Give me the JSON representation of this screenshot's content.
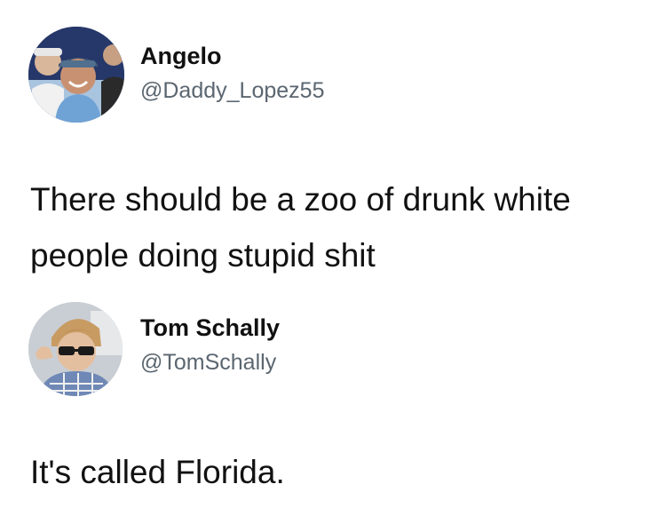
{
  "tweets": [
    {
      "author_name": "Angelo",
      "author_handle": "@Daddy_Lopez55",
      "text_lines": [
        "There should be a zoo of drunk white",
        "people doing stupid shit"
      ],
      "avatar_icon": "profile-photo-group-icon"
    },
    {
      "author_name": "Tom Schally",
      "author_handle": "@TomSchally",
      "text_lines": [
        "It's called Florida."
      ],
      "avatar_icon": "profile-photo-sunglasses-icon"
    }
  ]
}
